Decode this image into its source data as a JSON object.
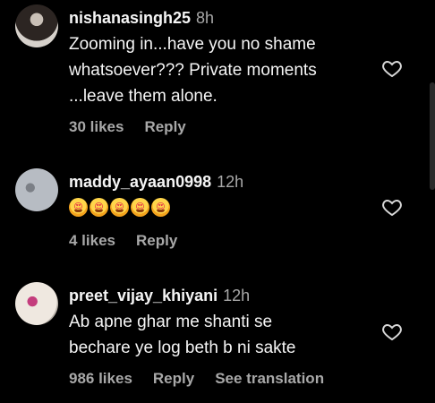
{
  "comments": [
    {
      "username": "nishanasingh25",
      "time": "8h",
      "text": "Zooming in...have you no shame\nwhatsoever??? Private moments\n...leave them alone.",
      "likes": "30 likes",
      "reply": "Reply"
    },
    {
      "username": "maddy_ayaan0998",
      "time": "12h",
      "emojis": [
        "😍",
        "😍",
        "😍",
        "😍",
        "😍"
      ],
      "likes": "4 likes",
      "reply": "Reply"
    },
    {
      "username": "preet_vijay_khiyani",
      "time": "12h",
      "text": "Ab apne ghar me shanti se\nbechare ye log beth b ni sakte",
      "likes": "986 likes",
      "reply": "Reply",
      "translation": "See translation"
    }
  ],
  "icons": {
    "avatar": "avatar-icon",
    "like": "heart-outline-icon"
  },
  "colors": {
    "background": "#000000",
    "primary_text": "#f5f5f5",
    "secondary_text": "#a8a8a8"
  }
}
